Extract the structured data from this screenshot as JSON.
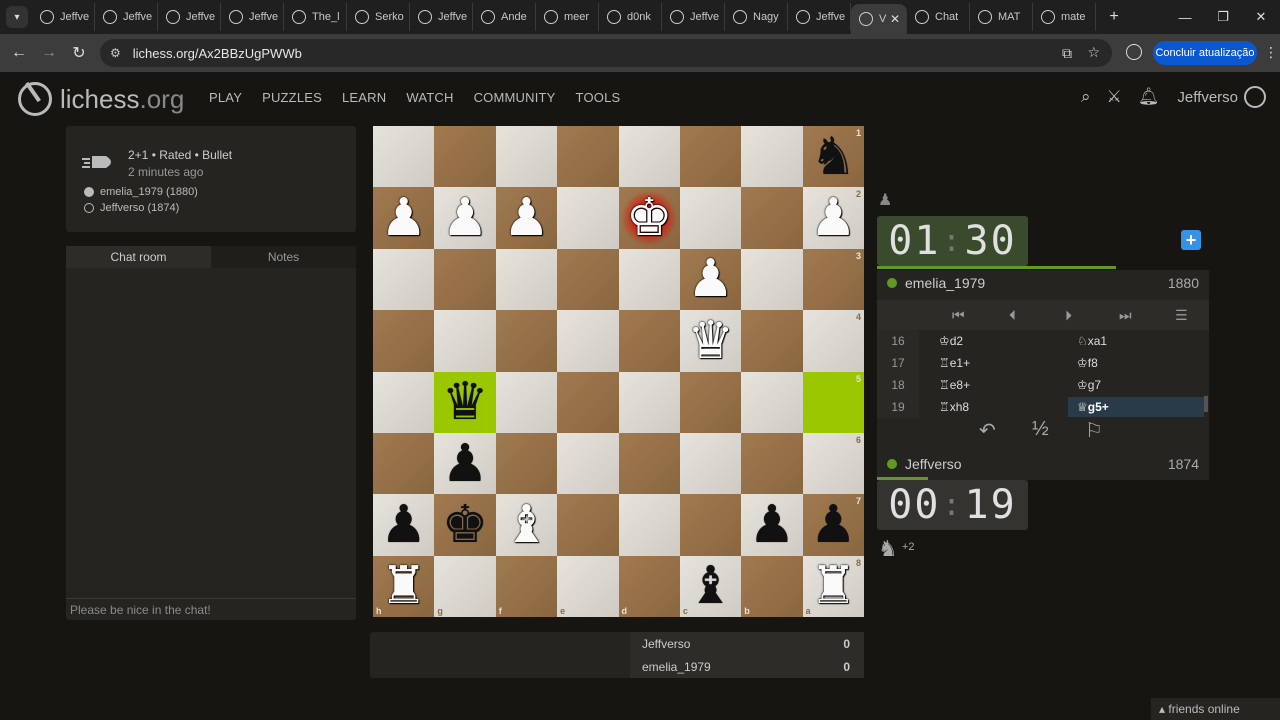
{
  "browser": {
    "tabs": [
      {
        "label": "Jeffve"
      },
      {
        "label": "Jeffve"
      },
      {
        "label": "Jeffve"
      },
      {
        "label": "Jeffve"
      },
      {
        "label": "The_l"
      },
      {
        "label": "Serko"
      },
      {
        "label": "Jeffve"
      },
      {
        "label": "Ande"
      },
      {
        "label": "meer"
      },
      {
        "label": "d0nk"
      },
      {
        "label": "Jeffve"
      },
      {
        "label": "Nagy"
      },
      {
        "label": "Jeffve"
      }
    ],
    "active_tab": "V",
    "extra_tabs": [
      {
        "label": "Chat"
      },
      {
        "label": "MAT"
      },
      {
        "label": "mate"
      }
    ],
    "url": "lichess.org/Ax2BBzUgPWWb",
    "update_button": "Concluir atualização"
  },
  "site": {
    "logo_main": "lichess",
    "logo_org": ".org",
    "nav": [
      "PLAY",
      "PUZZLES",
      "LEARN",
      "WATCH",
      "COMMUNITY",
      "TOOLS"
    ],
    "username": "Jeffverso"
  },
  "game": {
    "type": "2+1 • Rated • Bullet",
    "time_ago": "2 minutes ago",
    "white": "emelia_1979 (1880)",
    "black": "Jeffverso (1874)"
  },
  "chat": {
    "tab_chat": "Chat room",
    "tab_notes": "Notes",
    "placeholder": "Please be nice in the chat!"
  },
  "board": {
    "files": [
      "h",
      "g",
      "f",
      "e",
      "d",
      "c",
      "b",
      "a"
    ],
    "ranks": [
      "1",
      "2",
      "3",
      "4",
      "5",
      "6",
      "7",
      "8"
    ],
    "pieces": [
      [
        "",
        "",
        "",
        "",
        "",
        "",
        "",
        "bN"
      ],
      [
        "wP",
        "wP",
        "wP",
        "",
        "wK",
        "",
        "",
        "wP"
      ],
      [
        "",
        "",
        "",
        "",
        "",
        "wP",
        "",
        ""
      ],
      [
        "",
        "",
        "",
        "",
        "",
        "wQ",
        "",
        ""
      ],
      [
        "",
        "bQ",
        "",
        "",
        "",
        "",
        "",
        ""
      ],
      [
        "",
        "bP",
        "",
        "",
        "",
        "",
        "",
        ""
      ],
      [
        "bP",
        "bK",
        "wB",
        "",
        "",
        "",
        "bP",
        "bP"
      ],
      [
        "wR",
        "",
        "",
        "",
        "",
        "bB",
        "",
        "wR"
      ]
    ],
    "highlight_squares": [
      "g5",
      "a5"
    ],
    "check_square": "d2"
  },
  "score": {
    "rows": [
      {
        "name": "Jeffverso",
        "points": "0"
      },
      {
        "name": "emelia_1979",
        "points": "0"
      }
    ]
  },
  "clocks": {
    "top": {
      "min": "01",
      "sec": "30",
      "bar_fraction": 0.92
    },
    "bottom": {
      "min": "00",
      "sec": "19",
      "bar_fraction": 0.17
    }
  },
  "players": {
    "top": {
      "name": "emelia_1979",
      "rating": "1880"
    },
    "bottom": {
      "name": "Jeffverso",
      "rating": "1874"
    }
  },
  "moves": [
    {
      "num": "16",
      "white": "♔d2",
      "black": "♘xa1"
    },
    {
      "num": "17",
      "white": "♖e1+",
      "black": "♔f8"
    },
    {
      "num": "18",
      "white": "♖e8+",
      "black": "♔g7"
    },
    {
      "num": "19",
      "white": "♖xh8",
      "black": "♕g5+"
    }
  ],
  "material": {
    "top": "",
    "bottom": "+2"
  },
  "friends": "friends online"
}
